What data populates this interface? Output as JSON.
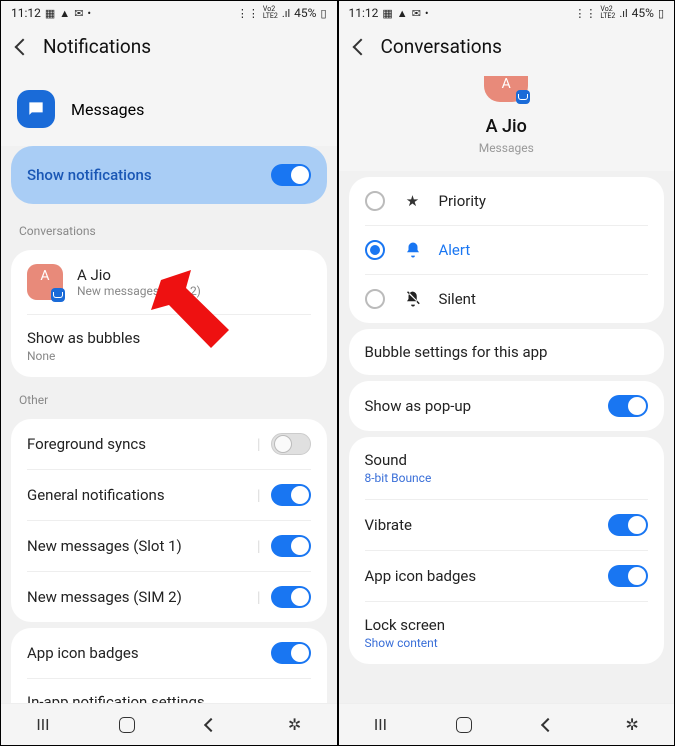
{
  "status": {
    "time": "11:12",
    "network": "LTE2",
    "signal": ".ıl",
    "battery_pct": "45%"
  },
  "left_screen": {
    "header_title": "Notifications",
    "app_name": "Messages",
    "show_notifications": {
      "label": "Show notifications",
      "on": true
    },
    "conversations_label": "Conversations",
    "conversation": {
      "name": "A Jio",
      "sub": "New messages (SIM 2)"
    },
    "show_bubbles": {
      "label": "Show as bubbles",
      "sub": "None"
    },
    "other_label": "Other",
    "items": [
      {
        "label": "Foreground syncs",
        "on": false
      },
      {
        "label": "General notifications",
        "on": true
      },
      {
        "label": "New messages (Slot 1)",
        "on": true
      },
      {
        "label": "New messages (SIM 2)",
        "on": true
      }
    ],
    "app_icon_badges": {
      "label": "App icon badges",
      "on": true
    },
    "in_app": {
      "label": "In-app notification settings"
    }
  },
  "right_screen": {
    "header_title": "Conversations",
    "contact": {
      "name": "A Jio",
      "app": "Messages"
    },
    "options": [
      {
        "key": "priority",
        "label": "Priority",
        "selected": false
      },
      {
        "key": "alert",
        "label": "Alert",
        "selected": true
      },
      {
        "key": "silent",
        "label": "Silent",
        "selected": false
      }
    ],
    "bubble_settings": "Bubble settings for this app",
    "show_popup": {
      "label": "Show as pop-up",
      "on": true
    },
    "sound": {
      "label": "Sound",
      "value": "8-bit Bounce"
    },
    "vibrate": {
      "label": "Vibrate",
      "on": true
    },
    "app_icon_badges": {
      "label": "App icon badges",
      "on": true
    },
    "lock_screen": {
      "label": "Lock screen",
      "value": "Show content"
    }
  }
}
